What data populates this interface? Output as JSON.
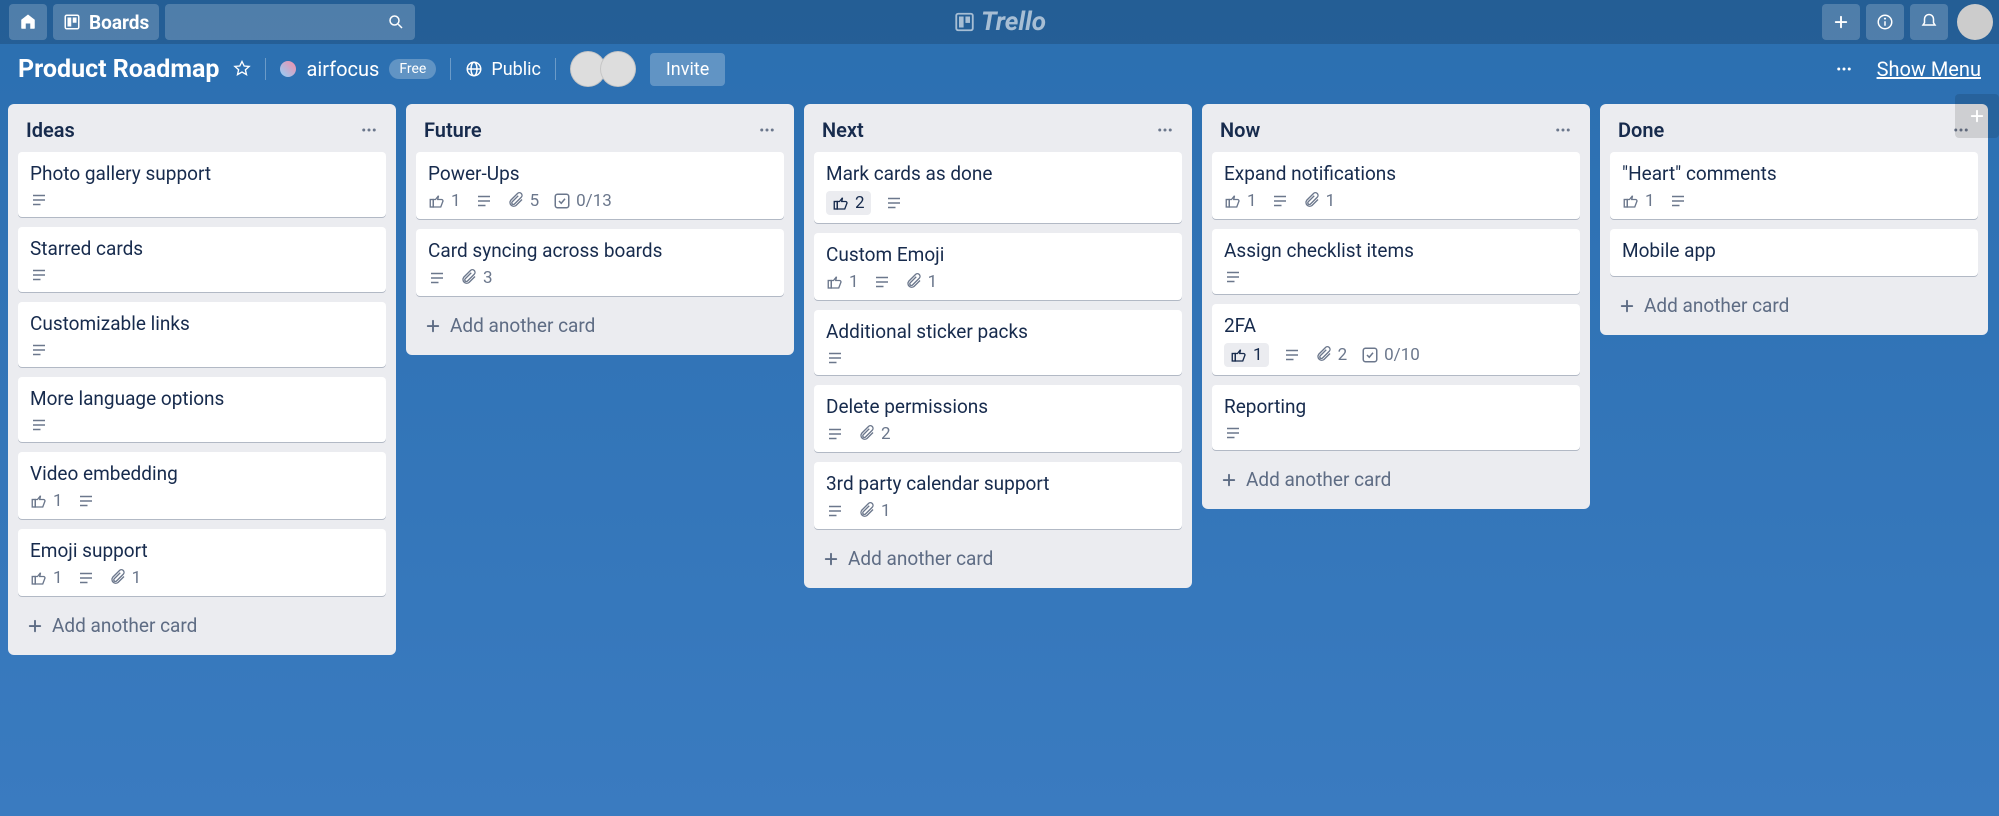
{
  "topnav": {
    "boards_label": "Boards",
    "logo_text": "Trello"
  },
  "boardbar": {
    "title": "Product Roadmap",
    "team": "airfocus",
    "plan": "Free",
    "visibility": "Public",
    "invite": "Invite",
    "show_menu": "Show Menu"
  },
  "lists": [
    {
      "title": "Ideas",
      "cards": [
        {
          "title": "Photo gallery support",
          "badges": [
            {
              "t": "desc"
            }
          ]
        },
        {
          "title": "Starred cards",
          "badges": [
            {
              "t": "desc"
            }
          ]
        },
        {
          "title": "Customizable links",
          "badges": [
            {
              "t": "desc"
            }
          ]
        },
        {
          "title": "More language options",
          "badges": [
            {
              "t": "desc"
            }
          ]
        },
        {
          "title": "Video embedding",
          "badges": [
            {
              "t": "vote",
              "v": "1"
            },
            {
              "t": "desc"
            }
          ]
        },
        {
          "title": "Emoji support",
          "badges": [
            {
              "t": "vote",
              "v": "1"
            },
            {
              "t": "desc"
            },
            {
              "t": "attach",
              "v": "1"
            }
          ]
        }
      ],
      "add": "Add another card"
    },
    {
      "title": "Future",
      "cards": [
        {
          "title": "Power-Ups",
          "badges": [
            {
              "t": "vote",
              "v": "1"
            },
            {
              "t": "desc"
            },
            {
              "t": "attach",
              "v": "5"
            },
            {
              "t": "check",
              "v": "0/13"
            }
          ]
        },
        {
          "title": "Card syncing across boards",
          "badges": [
            {
              "t": "desc"
            },
            {
              "t": "attach",
              "v": "3"
            }
          ]
        }
      ],
      "add": "Add another card"
    },
    {
      "title": "Next",
      "cards": [
        {
          "title": "Mark cards as done",
          "badges": [
            {
              "t": "vote",
              "v": "2",
              "voted": true
            },
            {
              "t": "desc"
            }
          ]
        },
        {
          "title": "Custom Emoji",
          "badges": [
            {
              "t": "vote",
              "v": "1"
            },
            {
              "t": "desc"
            },
            {
              "t": "attach",
              "v": "1"
            }
          ]
        },
        {
          "title": "Additional sticker packs",
          "badges": [
            {
              "t": "desc"
            }
          ]
        },
        {
          "title": "Delete permissions",
          "badges": [
            {
              "t": "desc"
            },
            {
              "t": "attach",
              "v": "2"
            }
          ]
        },
        {
          "title": "3rd party calendar support",
          "badges": [
            {
              "t": "desc"
            },
            {
              "t": "attach",
              "v": "1"
            }
          ]
        }
      ],
      "add": "Add another card"
    },
    {
      "title": "Now",
      "cards": [
        {
          "title": "Expand notifications",
          "badges": [
            {
              "t": "vote",
              "v": "1"
            },
            {
              "t": "desc"
            },
            {
              "t": "attach",
              "v": "1"
            }
          ]
        },
        {
          "title": "Assign checklist items",
          "badges": [
            {
              "t": "desc"
            }
          ]
        },
        {
          "title": "2FA",
          "badges": [
            {
              "t": "vote",
              "v": "1",
              "voted": true
            },
            {
              "t": "desc"
            },
            {
              "t": "attach",
              "v": "2"
            },
            {
              "t": "check",
              "v": "0/10"
            }
          ]
        },
        {
          "title": "Reporting",
          "badges": [
            {
              "t": "desc"
            }
          ]
        }
      ],
      "add": "Add another card"
    },
    {
      "title": "Done",
      "cards": [
        {
          "title": "\"Heart\" comments",
          "badges": [
            {
              "t": "vote",
              "v": "1"
            },
            {
              "t": "desc"
            }
          ]
        },
        {
          "title": "Mobile app",
          "badges": []
        }
      ],
      "add": "Add another card"
    }
  ]
}
